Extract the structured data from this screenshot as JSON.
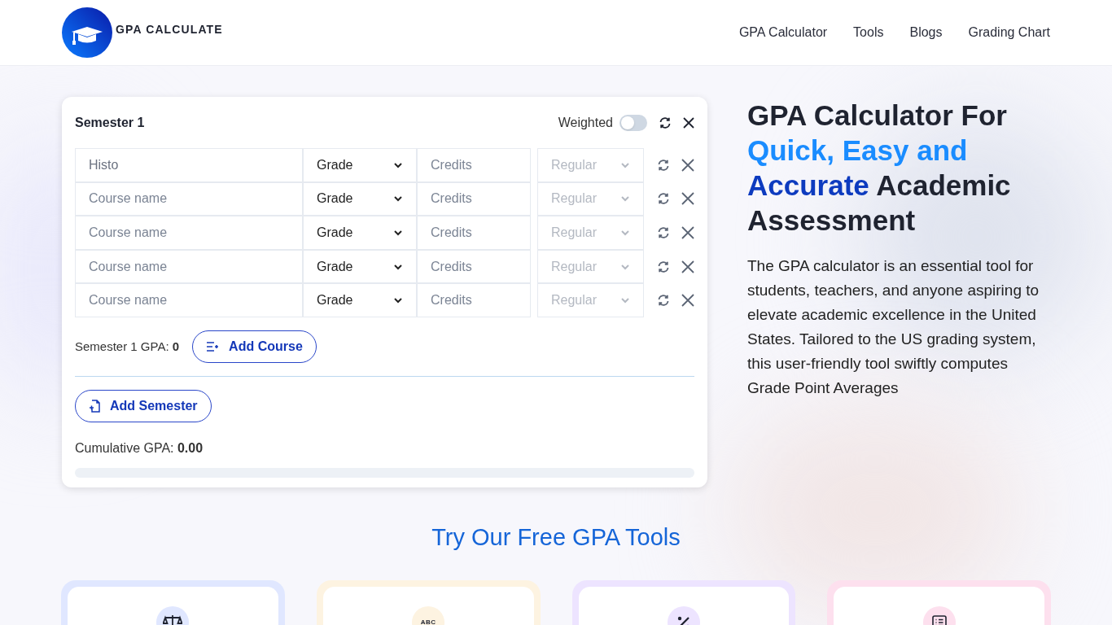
{
  "header": {
    "logo_text": "GPA CALCULATE",
    "nav": [
      {
        "label": "GPA Calculator"
      },
      {
        "label": "Tools"
      },
      {
        "label": "Blogs"
      },
      {
        "label": "Grading Chart"
      }
    ]
  },
  "calculator": {
    "semester_title": "Semester 1",
    "weighted_label": "Weighted",
    "weighted_on": false,
    "rows": [
      {
        "course": {
          "value": "Histo"
        },
        "grade": "Grade",
        "credits_placeholder": "Credits",
        "type": "Regular",
        "type_disabled": true
      },
      {
        "course": {
          "placeholder": "Course name"
        },
        "grade": "Grade",
        "credits_placeholder": "Credits",
        "type": "Regular",
        "type_disabled": true
      },
      {
        "course": {
          "placeholder": "Course name"
        },
        "grade": "Grade",
        "credits_placeholder": "Credits",
        "type": "Regular",
        "type_disabled": true
      },
      {
        "course": {
          "placeholder": "Course name"
        },
        "grade": "Grade",
        "credits_placeholder": "Credits",
        "type": "Regular",
        "type_disabled": true
      },
      {
        "course": {
          "placeholder": "Course name"
        },
        "grade": "Grade",
        "credits_placeholder": "Credits",
        "type": "Regular",
        "type_disabled": true
      }
    ],
    "semester_gpa": "Semester 1 GPA: **0**",
    "add_course": "Add Course",
    "add_semester": "Add Semester",
    "cumulative_gpa": "Cumulative GPA: **0.00**",
    "progress": {
      "level": 0
    }
  },
  "hero": {
    "title": [
      {
        "text": "GPA Calculator For ",
        "kind": "plain"
      },
      {
        "text": "Quick, Easy and ",
        "kind": "light"
      },
      {
        "text": "Accurate",
        "kind": "dark"
      },
      {
        "text": " Academic Assessment",
        "kind": "plain"
      }
    ],
    "description": "The GPA calculator is an essential tool for students, teachers, and anyone aspiring to elevate academic excellence in the United States. Tailored to the US grading system, this user-friendly tool swiftly computes Grade Point Averages"
  },
  "tools": {
    "title": "Try Our Free GPA Tools",
    "cards": [
      {
        "kind": "scale",
        "color": "#e0e7ff"
      },
      {
        "kind": "abc",
        "icon_text": "ABC",
        "color": "#fdf3e1"
      },
      {
        "kind": "percent",
        "color": "#ede4ff"
      },
      {
        "kind": "list",
        "color": "#fde0ee"
      }
    ]
  }
}
